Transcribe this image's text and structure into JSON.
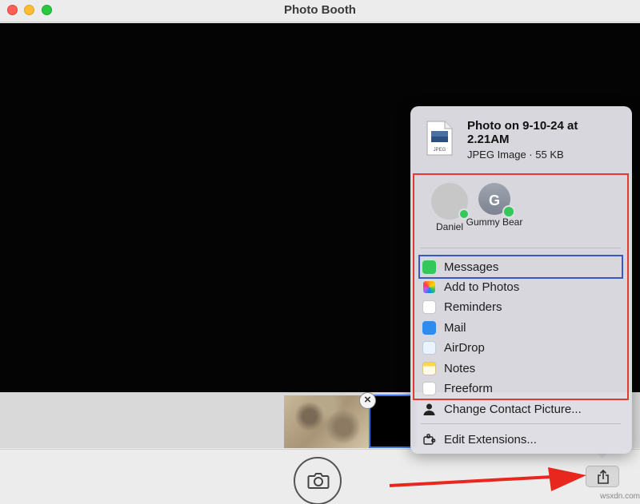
{
  "window": {
    "title": "Photo Booth"
  },
  "share_sheet": {
    "file_name": "Photo on 9-10-24 at 2.21AM",
    "file_meta": "JPEG Image · 55 KB",
    "file_icon_label": "JPEG",
    "contacts": [
      {
        "name": "Daniel",
        "initial": ""
      },
      {
        "name": "Gummy Bear",
        "initial": "G"
      }
    ],
    "items": [
      {
        "label": "Messages",
        "icon": "messages-icon"
      },
      {
        "label": "Add to Photos",
        "icon": "photos-icon"
      },
      {
        "label": "Reminders",
        "icon": "reminders-icon"
      },
      {
        "label": "Mail",
        "icon": "mail-icon"
      },
      {
        "label": "AirDrop",
        "icon": "airdrop-icon"
      },
      {
        "label": "Notes",
        "icon": "notes-icon"
      },
      {
        "label": "Freeform",
        "icon": "freeform-icon"
      }
    ],
    "change_contact_picture": "Change Contact Picture...",
    "edit_extensions": "Edit Extensions..."
  },
  "watermark": "wsxdn.com",
  "colors": {
    "highlight_red": "#e13a2e",
    "highlight_blue": "#3a56c8",
    "arrow_red": "#e8281f"
  }
}
